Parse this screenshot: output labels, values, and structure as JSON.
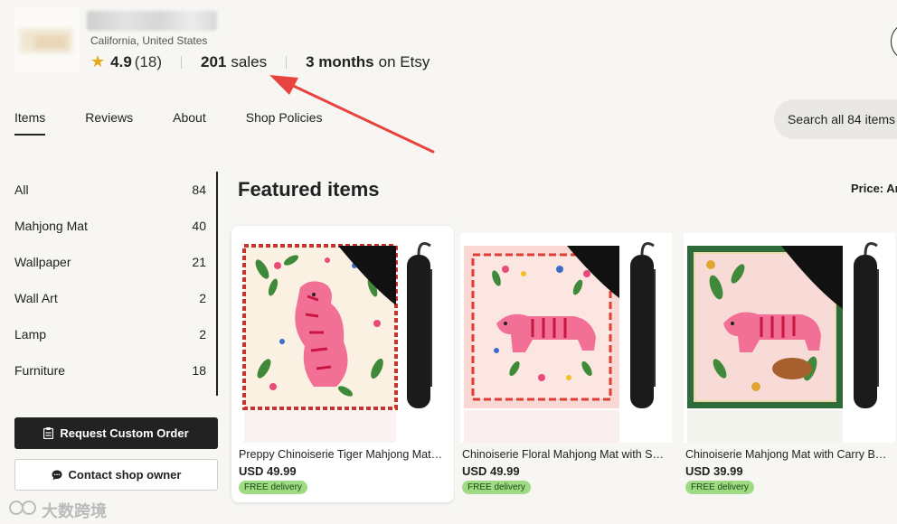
{
  "shop": {
    "location": "California, United States",
    "rating": "4.9",
    "rating_count": "(18)",
    "sales_count": "201",
    "sales_label": "sales",
    "months_value": "3 months",
    "months_label": "on Etsy"
  },
  "tabs": [
    "Items",
    "Reviews",
    "About",
    "Shop Policies"
  ],
  "search_all_label": "Search all 84 items",
  "categories": [
    {
      "label": "All",
      "count": "84"
    },
    {
      "label": "Mahjong Mat",
      "count": "40"
    },
    {
      "label": "Wallpaper",
      "count": "21"
    },
    {
      "label": "Wall Art",
      "count": "2"
    },
    {
      "label": "Lamp",
      "count": "2"
    },
    {
      "label": "Furniture",
      "count": "18"
    }
  ],
  "buttons": {
    "request_custom": "Request Custom Order",
    "contact_owner": "Contact shop owner"
  },
  "featured": {
    "title": "Featured items",
    "price_filter": "Price: Ar"
  },
  "products": [
    {
      "title": "Preppy Chinoiserie Tiger Mahjong Mat with Bag",
      "price": "USD 49.99",
      "badge": "FREE delivery"
    },
    {
      "title": "Chinoiserie Floral Mahjong Mat with Storage Bag",
      "price": "USD 49.99",
      "badge": "FREE delivery"
    },
    {
      "title": "Chinoiserie Mahjong Mat with Carry Bag Tiger",
      "price": "USD 39.99",
      "badge": "FREE delivery"
    }
  ],
  "watermark": "大数跨境",
  "colors": {
    "accent_star": "#e7a91b",
    "badge_green": "#9edb83",
    "annotation_red": "#e8443f"
  }
}
